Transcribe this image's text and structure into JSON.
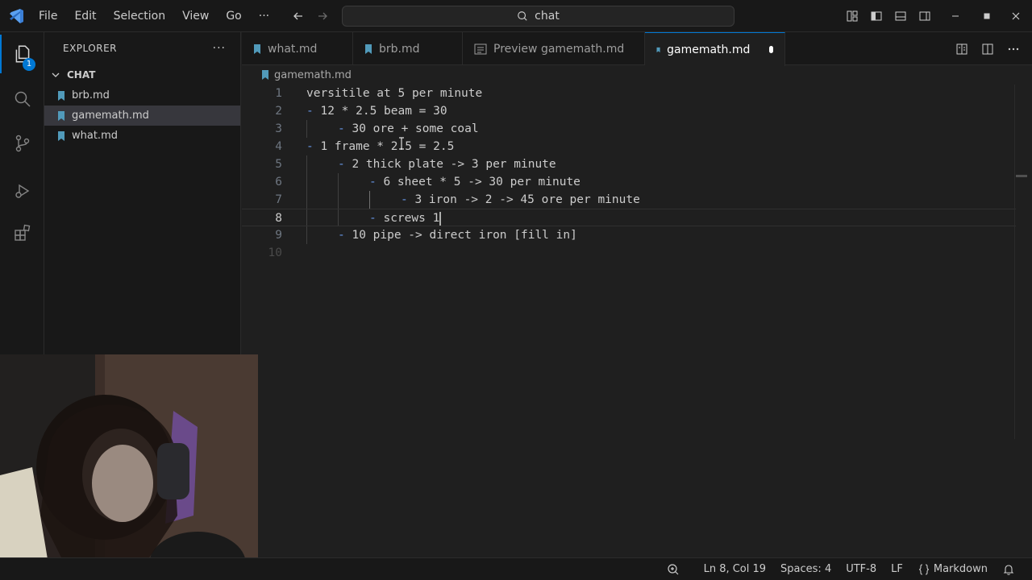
{
  "menu": {
    "items": [
      "File",
      "Edit",
      "Selection",
      "View",
      "Go",
      "···"
    ]
  },
  "command_center": {
    "text": "chat"
  },
  "activity_bar": {
    "explorer_badge": "1"
  },
  "sidebar": {
    "title": "EXPLORER",
    "more": "···",
    "folder": "CHAT",
    "files": [
      {
        "name": "brb.md"
      },
      {
        "name": "gamemath.md"
      },
      {
        "name": "what.md"
      }
    ]
  },
  "tabs": [
    {
      "label": "what.md"
    },
    {
      "label": "brb.md"
    },
    {
      "label": "Preview gamemath.md"
    },
    {
      "label": "gamemath.md"
    }
  ],
  "breadcrumb": {
    "file": "gamemath.md"
  },
  "editor": {
    "lines": [
      {
        "num": "1",
        "dash": "",
        "text": "versitile at 5 per minute"
      },
      {
        "num": "2",
        "dash": "-",
        "text": "12 * 2.5 beam = 30"
      },
      {
        "num": "3",
        "dash": "-",
        "text": "30 ore + some coal"
      },
      {
        "num": "4",
        "dash": "-",
        "text": "1 frame * 2.5 = 2.5"
      },
      {
        "num": "5",
        "dash": "-",
        "text": "2 thick plate -> 3 per minute"
      },
      {
        "num": "6",
        "dash": "-",
        "text": "6 sheet * 5 -> 30 per minute"
      },
      {
        "num": "7",
        "dash": "-",
        "text": "3 iron -> 2 -> 45 ore per minute"
      },
      {
        "num": "8",
        "dash": "-",
        "text": "screws 1"
      },
      {
        "num": "9",
        "dash": "-",
        "text": "10 pipe -> direct iron [fill in]"
      },
      {
        "num": "10",
        "dash": "",
        "text": ""
      }
    ]
  },
  "statusbar": {
    "position": "Ln 8, Col 19",
    "spaces": "Spaces: 4",
    "encoding": "UTF-8",
    "eol": "LF",
    "language": "Markdown"
  },
  "colors": {
    "accent": "#0078d4",
    "markdown_icon": "#519aba",
    "list_dash": "#6796e6"
  }
}
